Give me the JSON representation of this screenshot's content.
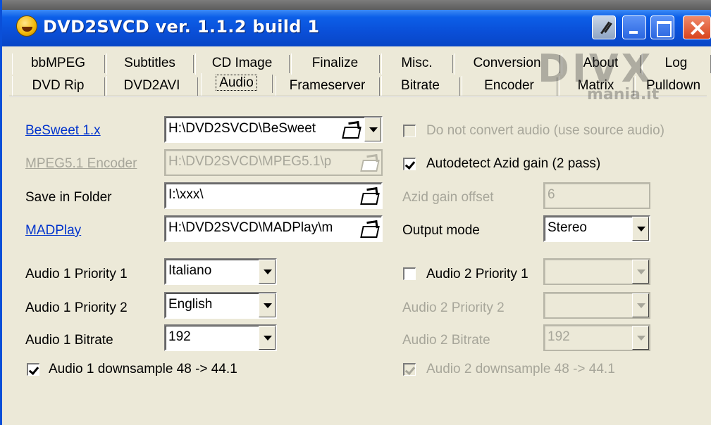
{
  "window": {
    "title": "DVD2SVCD ver. 1.1.2 build 1"
  },
  "tabs_row1": [
    "bbMPEG",
    "Subtitles",
    "CD Image",
    "Finalize",
    "Misc.",
    "Conversion",
    "About",
    "Log"
  ],
  "tabs_row2": [
    "DVD Rip",
    "DVD2AVI",
    "Audio",
    "Frameserver",
    "Bitrate",
    "Encoder",
    "Matrix",
    "Pulldown"
  ],
  "active_tab": "Audio",
  "left": {
    "besweet_label": "BeSweet 1.x",
    "besweet_value": "H:\\DVD2SVCD\\BeSweet",
    "mpeg51_label": "MPEG5.1 Encoder",
    "mpeg51_value": "H:\\DVD2SVCD\\MPEG5.1\\p",
    "save_label": "Save in Folder",
    "save_value": "I:\\xxx\\",
    "madplay_label": "MADPlay",
    "madplay_value": "H:\\DVD2SVCD\\MADPlay\\m",
    "a1p1_label": "Audio 1 Priority 1",
    "a1p1_value": "Italiano",
    "a1p2_label": "Audio 1 Priority 2",
    "a1p2_value": "English",
    "a1br_label": "Audio 1 Bitrate",
    "a1br_value": "192",
    "a1ds_label": "Audio 1 downsample 48 -> 44.1",
    "a1ds_checked": true
  },
  "right": {
    "noconvert_label": "Do not convert audio (use source audio)",
    "noconvert_checked": false,
    "azid_label": "Autodetect Azid gain (2 pass)",
    "azid_checked": true,
    "azid_offset_label": "Azid gain offset",
    "azid_offset_value": "6",
    "output_mode_label": "Output mode",
    "output_mode_value": "Stereo",
    "a2p1_label": "Audio 2 Priority 1",
    "a2p1_checked": false,
    "a2p1_value": "",
    "a2p2_label": "Audio 2 Priority 2",
    "a2p2_value": "",
    "a2br_label": "Audio 2 Bitrate",
    "a2br_value": "192",
    "a2ds_label": "Audio 2 downsample 48 -> 44.1",
    "a2ds_checked": true
  },
  "watermark": {
    "brand": "DIVX",
    "sub": "mania.it"
  }
}
